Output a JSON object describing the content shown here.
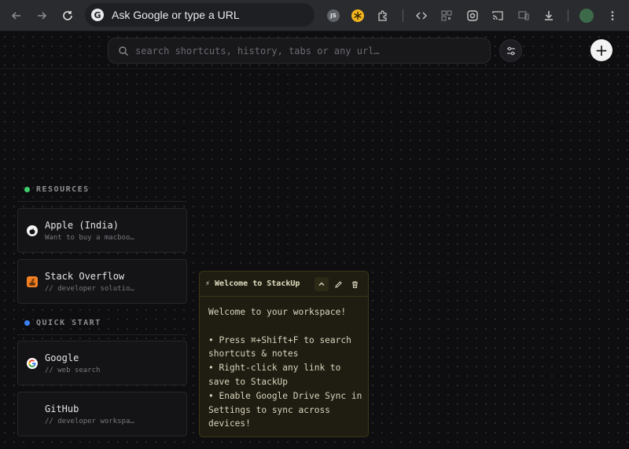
{
  "browser": {
    "omnibox_text": "Ask Google or type a URL",
    "google_letter": "G",
    "extension_js_label": "JS"
  },
  "app": {
    "search": {
      "placeholder": "search shortcuts, history, tabs or any url…"
    },
    "add_label": "+",
    "sections": [
      {
        "title": "RESOURCES",
        "color": "#3ecf6e",
        "items": [
          {
            "title": "Apple (India)",
            "subtitle": "Want to buy a macboo…",
            "icon": "apple-icon"
          },
          {
            "title": "Stack Overflow",
            "subtitle": "// developer solutio…",
            "icon": "stackoverflow-icon"
          }
        ]
      },
      {
        "title": "QUICK START",
        "color": "#3b82f6",
        "items": [
          {
            "title": "Google",
            "subtitle": "// web search",
            "icon": "google-icon"
          },
          {
            "title": "GitHub",
            "subtitle": "// developer workspa…",
            "icon": "github-icon"
          }
        ]
      }
    ],
    "note": {
      "title": "⚡ Welcome to StackUp",
      "body": "Welcome to your workspace!\n\n• Press ⌘+Shift+F to search\nshortcuts & notes\n• Right-click any link to\nsave to StackUp\n• Enable Google Drive Sync in\nSettings to sync across\ndevices!"
    }
  }
}
